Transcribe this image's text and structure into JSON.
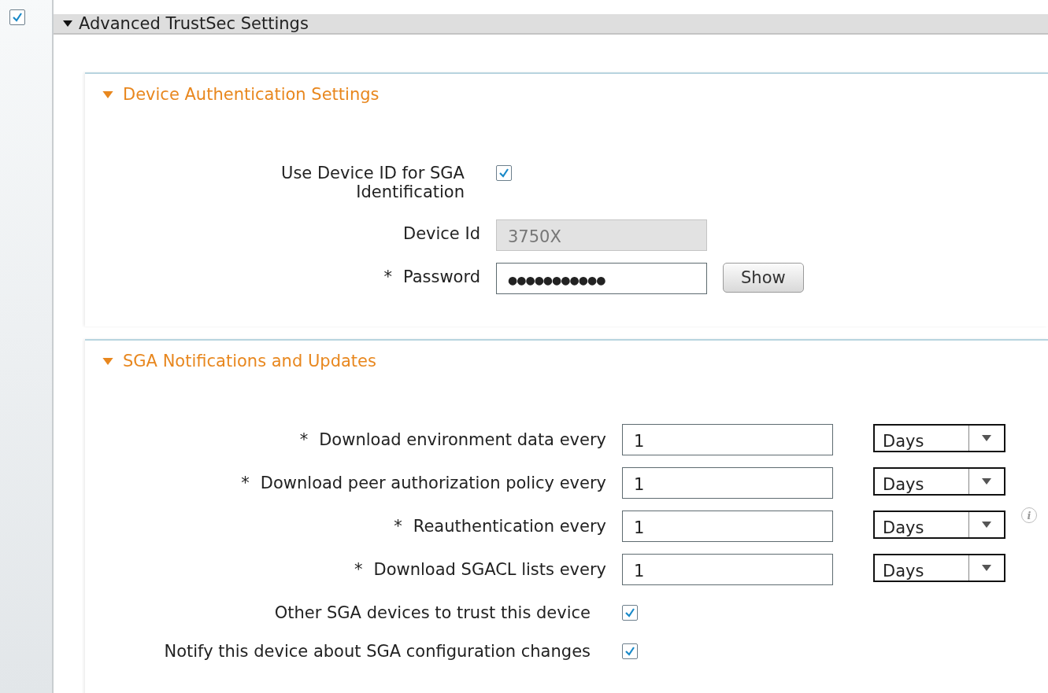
{
  "enable_checkbox": {
    "checked": true
  },
  "panel": {
    "title": "Advanced TrustSec Settings",
    "expanded": true
  },
  "sections": [
    {
      "title": "Device Authentication Settings",
      "expanded": true,
      "rows": [
        {
          "kind": "checkbox",
          "label": "Use Device ID for SGA Identification",
          "checked": true
        },
        {
          "kind": "text",
          "label": "Device Id",
          "value": "3750X",
          "disabled": true
        },
        {
          "kind": "password",
          "marker": "*",
          "label": "Password",
          "value": "●●●●●●●●●●●",
          "disabled": false,
          "button": "Show"
        }
      ]
    },
    {
      "title": "SGA Notifications and Updates",
      "expanded": true,
      "rows": [
        {
          "kind": "interval",
          "marker": "*",
          "label": "Download environment data every",
          "value": "1",
          "unit": "Days"
        },
        {
          "kind": "interval",
          "marker": "*",
          "label": "Download peer authorization policy every",
          "value": "1",
          "unit": "Days"
        },
        {
          "kind": "interval",
          "marker": "*",
          "label": "Reauthentication every",
          "value": "1",
          "unit": "Days",
          "info": "i"
        },
        {
          "kind": "interval",
          "marker": "*",
          "label": "Download SGACL lists every",
          "value": "1",
          "unit": "Days"
        },
        {
          "kind": "checkbox",
          "label": "Other SGA devices to trust this device",
          "checked": true
        },
        {
          "kind": "checkbox",
          "label": "Notify this device about SGA configuration changes",
          "checked": true
        }
      ]
    }
  ]
}
